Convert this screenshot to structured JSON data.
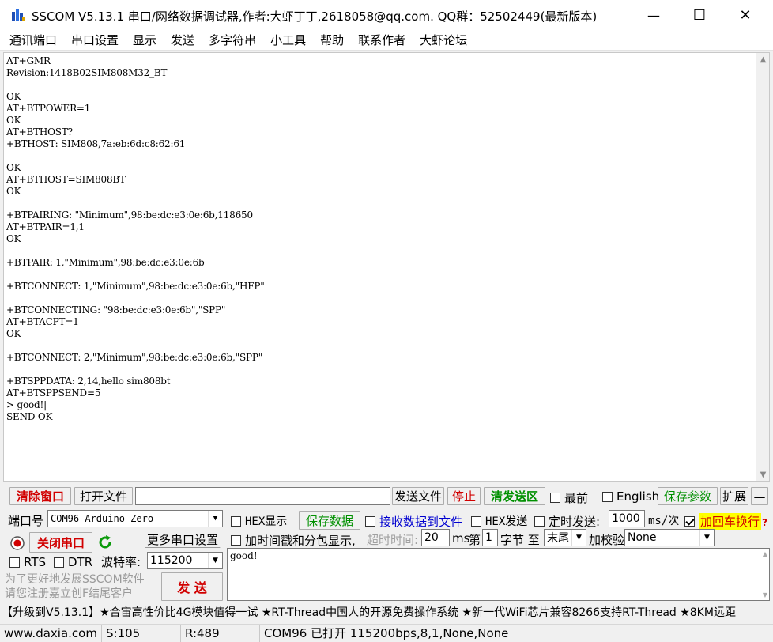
{
  "window": {
    "title": "SSCOM V5.13.1 串口/网络数据调试器,作者:大虾丁丁,2618058@qq.com. QQ群：52502449(最新版本)",
    "minimize": "—",
    "maximize": "☐",
    "close": "✕"
  },
  "menu": {
    "items": [
      "通讯端口",
      "串口设置",
      "显示",
      "发送",
      "多字符串",
      "小工具",
      "帮助",
      "联系作者",
      "大虾论坛"
    ]
  },
  "terminal": {
    "text": "AT+GMR\nRevision:1418B02SIM808M32_BT\n\nOK\nAT+BTPOWER=1\nOK\nAT+BTHOST?\n+BTHOST: SIM808,7a:eb:6d:c8:62:61\n\nOK\nAT+BTHOST=SIM808BT\nOK\n\n+BTPAIRING: \"Minimum\",98:be:dc:e3:0e:6b,118650\nAT+BTPAIR=1,1\nOK\n\n+BTPAIR: 1,\"Minimum\",98:be:dc:e3:0e:6b\n\n+BTCONNECT: 1,\"Minimum\",98:be:dc:e3:0e:6b,\"HFP\"\n\n+BTCONNECTING: \"98:be:dc:e3:0e:6b\",\"SPP\"\nAT+BTACPT=1\nOK\n\n+BTCONNECT: 2,\"Minimum\",98:be:dc:e3:0e:6b,\"SPP\"\n\n+BTSPPDATA: 2,14,hello sim808bt\nAT+BTSPPSEND=5\n> good!|\nSEND OK"
  },
  "toolbar": {
    "clear_window": "清除窗口",
    "open_file": "打开文件",
    "file_path": "",
    "send_file": "发送文件",
    "stop": "停止",
    "clear_send": "清发送区",
    "topmost": "最前",
    "english": "English",
    "save_params": "保存参数",
    "expand": "扩展",
    "collapse": "—"
  },
  "port": {
    "label": "端口号",
    "value": "COM96 Arduino Zero",
    "close_port": "关闭串口",
    "more_settings": "更多串口设置",
    "rts": "RTS",
    "dtr": "DTR",
    "baud_label": "波特率:",
    "baud_value": "115200"
  },
  "options": {
    "hex_display": "HEX显示",
    "save_data": "保存数据",
    "recv_to_file": "接收数据到文件",
    "hex_send": "HEX发送",
    "timed_send": "定时发送:",
    "interval": "1000",
    "interval_unit": "ms/次",
    "add_crlf": "加回车换行",
    "timestamp": "加时间戳和分包显示,",
    "timeout_label": "超时时间:",
    "timeout_value": "20",
    "timeout_unit": "ms",
    "nth_label": "第",
    "byte_index": "1",
    "byte_label": "字节 至",
    "end_value": "末尾",
    "checksum_label": "加校验",
    "checksum_value": "None",
    "help": "?"
  },
  "send": {
    "text": "good!",
    "button": "发 送",
    "hint_line1": "为了更好地发展SSCOM软件",
    "hint_line2": "请您注册嘉立创F结尾客户"
  },
  "marquee": {
    "text": "【升级到V5.13.1】★合宙高性价比4G模块值得一试 ★RT-Thread中国人的开源免费操作系统 ★新一代WiFi芯片兼容8266支持RT-Thread ★8KM远距"
  },
  "status": {
    "website": "www.daxia.com",
    "sent": "S:105",
    "received": "R:489",
    "port_status": "COM96 已打开  115200bps,8,1,None,None"
  },
  "colors": {
    "accent_red": "#d10000",
    "accent_green": "#009000",
    "accent_blue": "#0000d0",
    "crlf_highlight": "#ffff00"
  }
}
